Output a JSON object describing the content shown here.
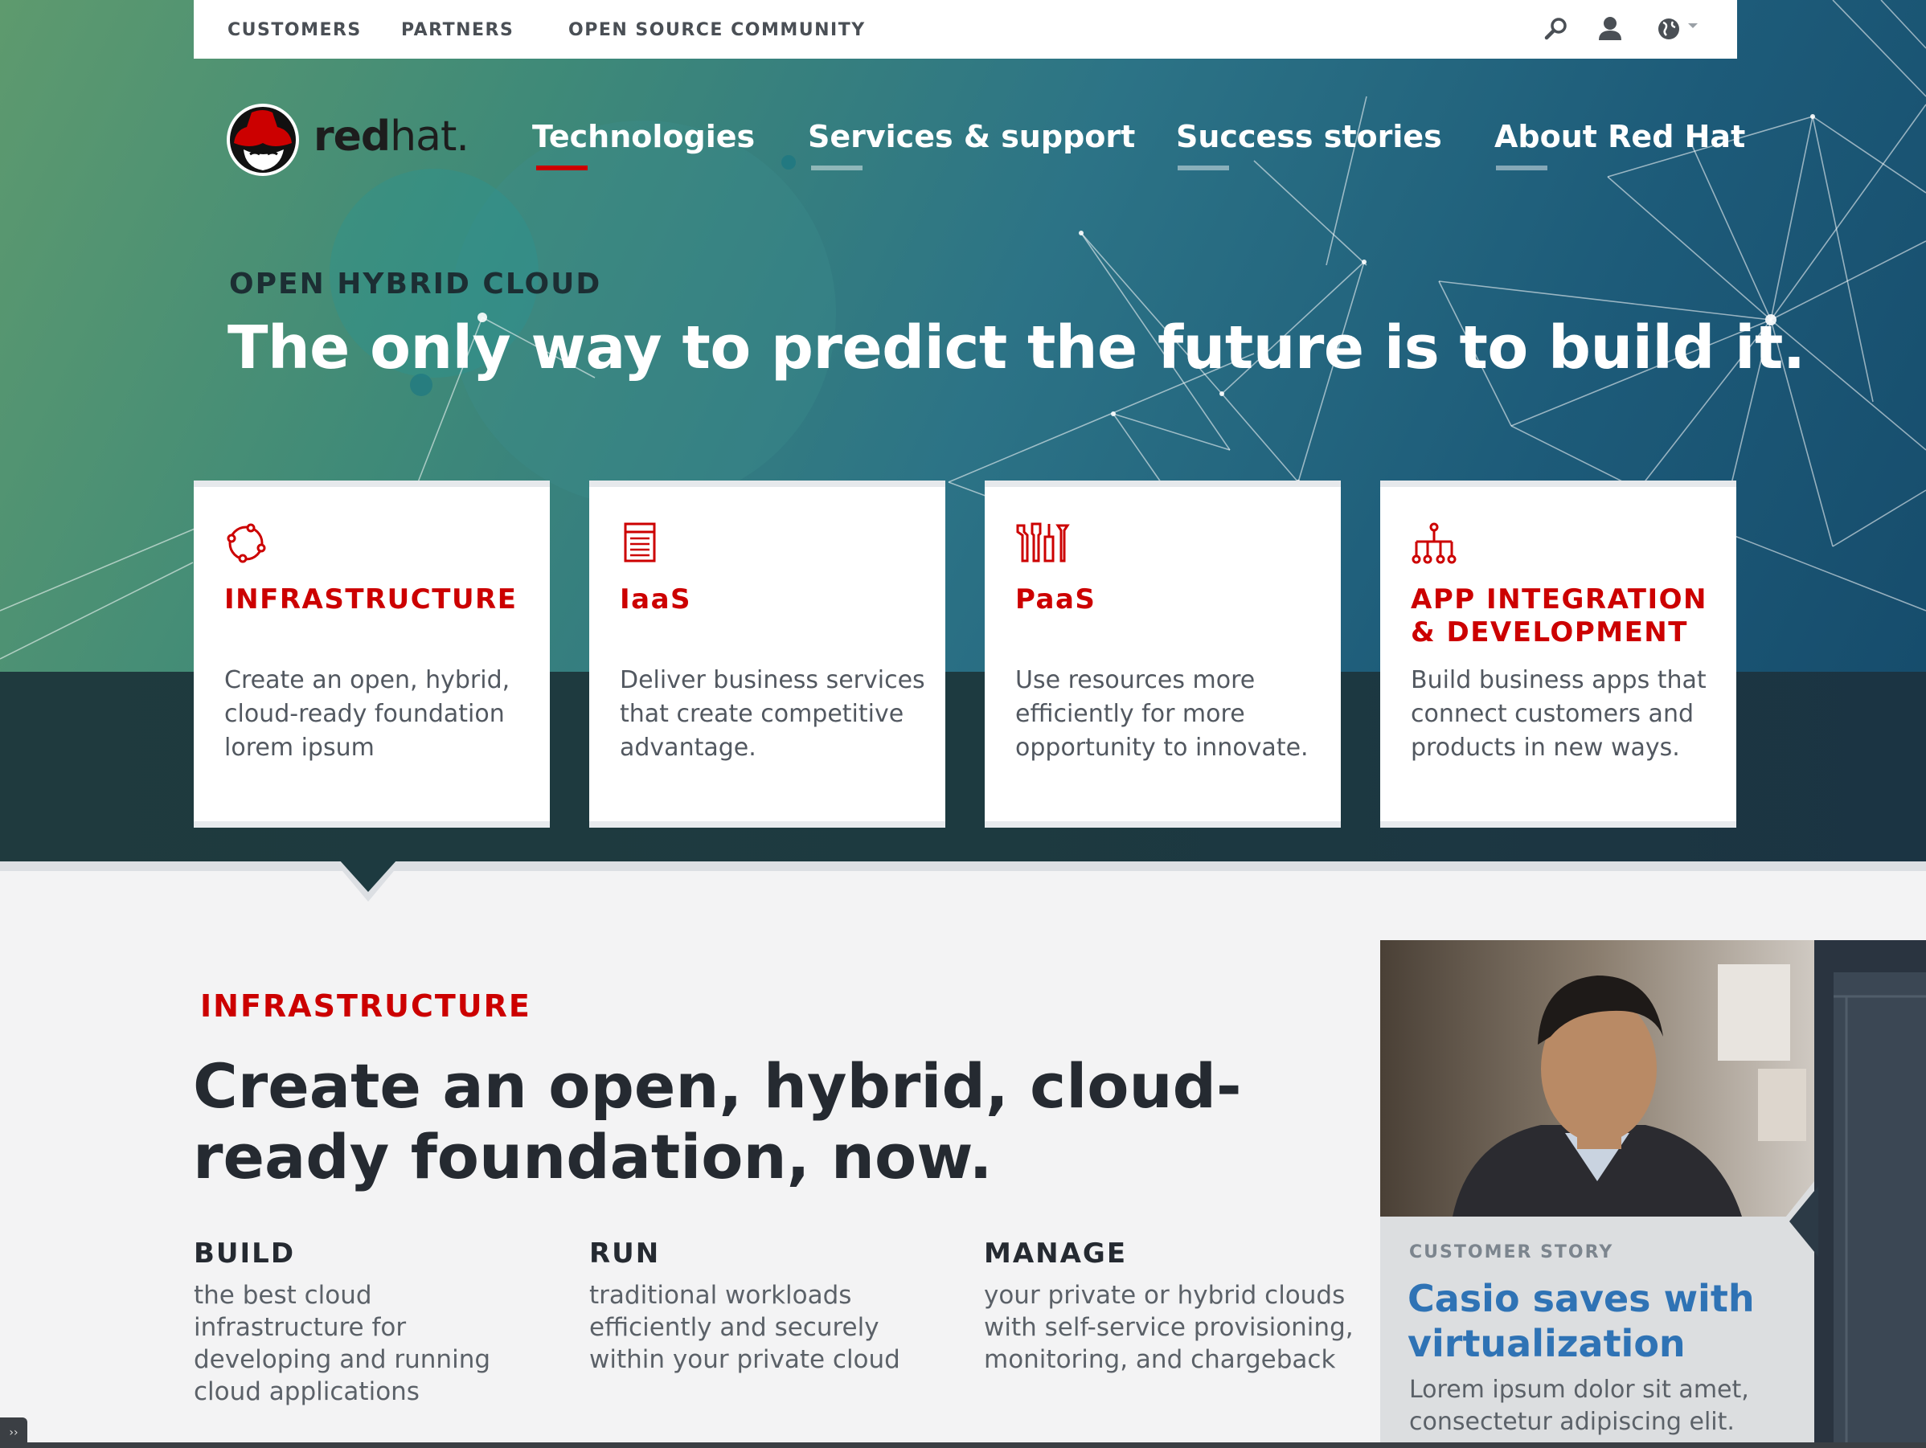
{
  "utility_nav": {
    "links": [
      "CUSTOMERS",
      "PARTNERS",
      "OPEN SOURCE COMMUNITY"
    ],
    "icons": [
      "search-icon",
      "user-icon",
      "globe-icon",
      "caret-down-icon"
    ]
  },
  "brand": {
    "logo_text_bold": "red",
    "logo_text_light": "hat."
  },
  "main_nav": {
    "items": [
      "Technologies",
      "Services & support",
      "Success stories",
      "About Red Hat"
    ],
    "active_index": 0
  },
  "hero": {
    "eyebrow": "OPEN HYBRID CLOUD",
    "headline": "The only way to predict the future is to build it."
  },
  "cards": [
    {
      "icon": "cloud-ring-icon",
      "title": "INFRASTRUCTURE",
      "body": "Create an open, hybrid, cloud-ready foundation lorem ipsum"
    },
    {
      "icon": "server-stack-icon",
      "title": "IaaS",
      "body": "Deliver business services that create competitive advantage."
    },
    {
      "icon": "tools-icon",
      "title": "PaaS",
      "body": "Use resources more efficiently for more opportunity to innovate."
    },
    {
      "icon": "network-tree-icon",
      "title": "APP INTEGRATION & DEVELOPMENT",
      "body": "Build business apps that connect customers and products in new ways."
    }
  ],
  "section": {
    "eyebrow": "INFRASTRUCTURE",
    "title": "Create an open, hybrid, cloud-ready foundation, now.",
    "columns": [
      {
        "title": "BUILD",
        "body": "the best cloud infrastructure for developing and running cloud applications"
      },
      {
        "title": "RUN",
        "body": "traditional workloads efficiently and securely within your private cloud"
      },
      {
        "title": "MANAGE",
        "body": "your private or hybrid clouds with self-service provisioning, monitoring, and chargeback"
      }
    ]
  },
  "story": {
    "label": "CUSTOMER STORY",
    "title": "Casio saves with virtualization",
    "body": "Lorem ipsum dolor sit amet, consectetur adipiscing elit."
  },
  "corner_tag": "››",
  "colors": {
    "brand_red": "#cc0000",
    "link_blue": "#2f73b5",
    "dark_text": "#252a31"
  }
}
